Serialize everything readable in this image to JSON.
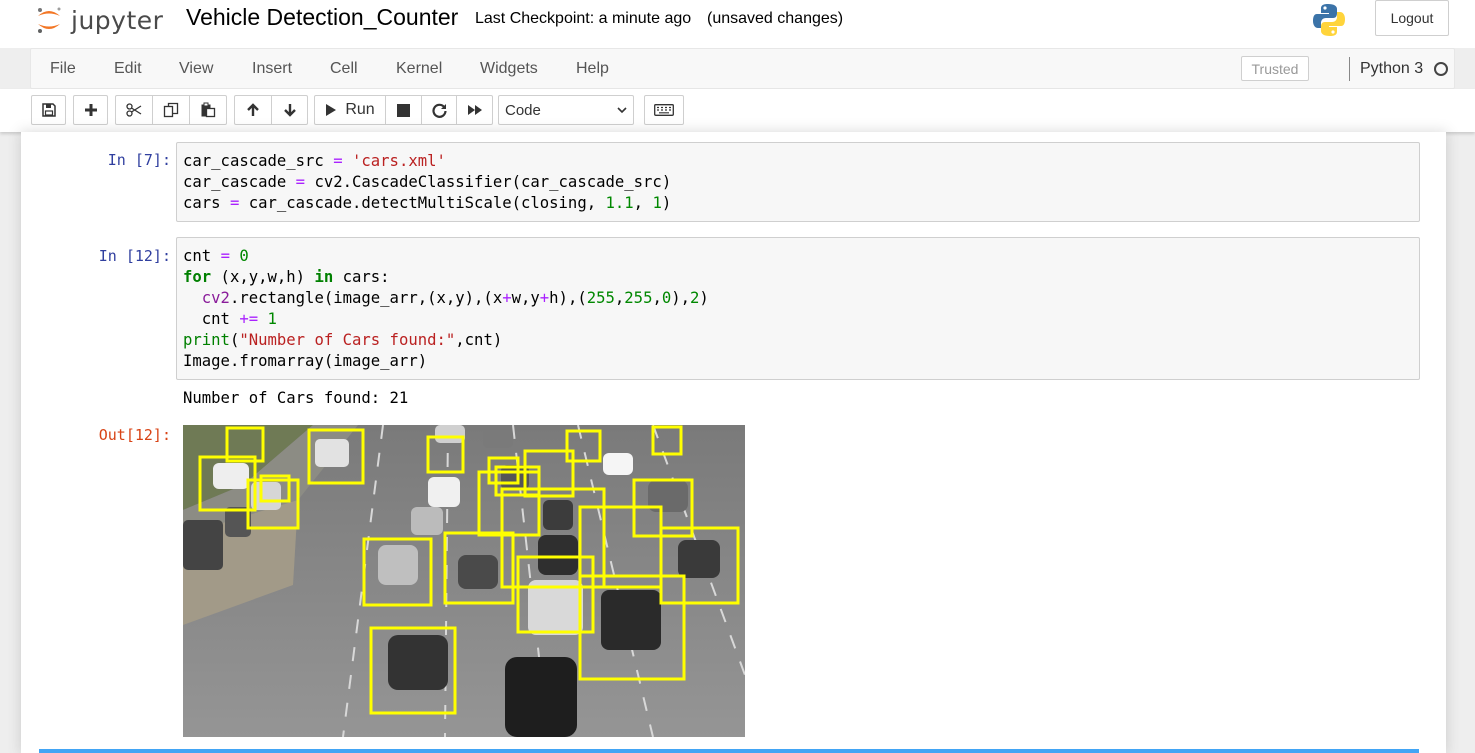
{
  "header": {
    "logo_text": "jupyter",
    "notebook_title": "Vehicle Detection_Counter",
    "checkpoint": "Last Checkpoint: a minute ago",
    "unsaved": "(unsaved changes)",
    "logout_label": "Logout"
  },
  "menubar": {
    "items": [
      "File",
      "Edit",
      "View",
      "Insert",
      "Cell",
      "Kernel",
      "Widgets",
      "Help"
    ],
    "trusted": "Trusted",
    "kernel_name": "Python 3"
  },
  "toolbar": {
    "run_label": "Run",
    "cell_type": "Code",
    "cell_type_options": [
      "Code"
    ],
    "icons": [
      "save-icon",
      "plus-icon",
      "scissors-icon",
      "copy-icon",
      "paste-icon",
      "arrow-up-icon",
      "arrow-down-icon",
      "play-icon",
      "stop-icon",
      "restart-icon",
      "fast-forward-icon",
      "keyboard-icon"
    ]
  },
  "cells": [
    {
      "prompt": "In [7]:",
      "lines": [
        "car_cascade_src = 'cars.xml'",
        "car_cascade = cv2.CascadeClassifier(car_cascade_src)",
        "cars = car_cascade.detectMultiScale(closing, 1.1, 1)"
      ]
    },
    {
      "prompt": "In [12]:",
      "lines": [
        "cnt = 0",
        "for (x,y,w,h) in cars:",
        "  cv2.rectangle(image_arr,(x,y),(x+w,y+h),(255,255,0),2)",
        "  cnt += 1",
        "print(\"Number of Cars found:\",cnt)",
        "Image.fromarray(image_arr)"
      ],
      "stdout": "Number of Cars found: 21",
      "out_prompt": "Out[12]:"
    }
  ],
  "colors": {
    "jupyter_orange": "#f37726",
    "in_prompt": "#303f9f",
    "out_prompt": "#d84315",
    "detection_box": "#ffff00"
  }
}
